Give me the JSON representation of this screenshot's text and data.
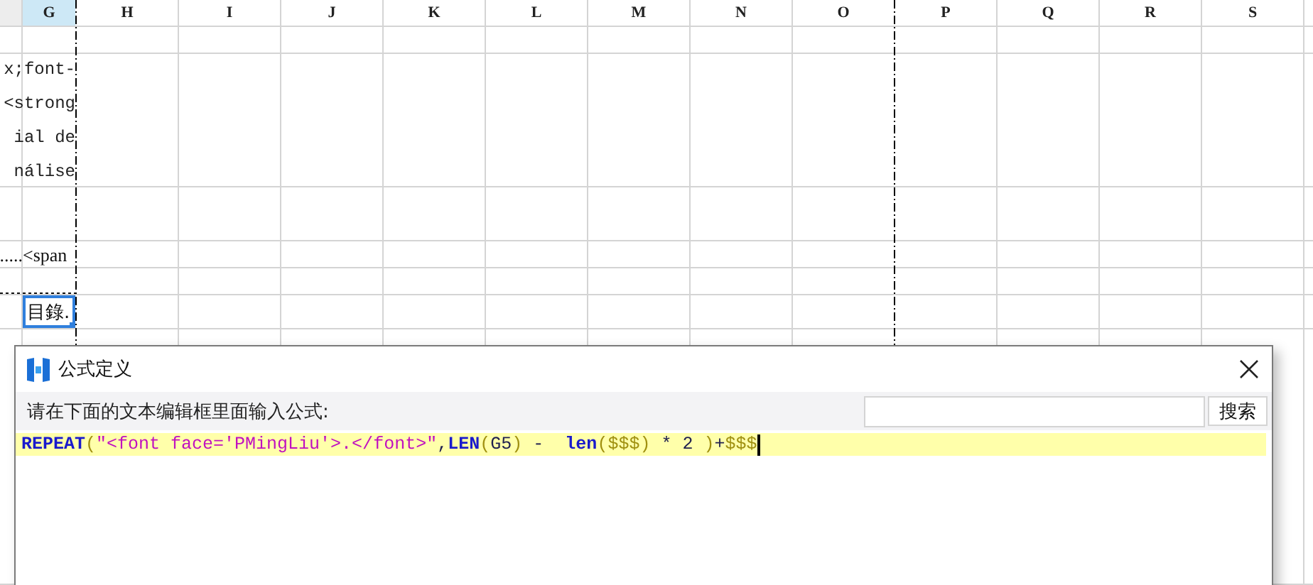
{
  "sheet": {
    "columns": [
      {
        "label": "G",
        "selected": true
      },
      {
        "label": "H",
        "selected": false
      },
      {
        "label": "I",
        "selected": false
      },
      {
        "label": "J",
        "selected": false
      },
      {
        "label": "K",
        "selected": false
      },
      {
        "label": "L",
        "selected": false
      },
      {
        "label": "M",
        "selected": false
      },
      {
        "label": "N",
        "selected": false
      },
      {
        "label": "O",
        "selected": false
      },
      {
        "label": "P",
        "selected": false
      },
      {
        "label": "Q",
        "selected": false
      },
      {
        "label": "R",
        "selected": false
      },
      {
        "label": "S",
        "selected": false
      }
    ],
    "rows": [
      {
        "kind": "plain"
      },
      {
        "kind": "wrapped",
        "lines": [
          "x;font-",
          "<strong",
          "ial de",
          "nálise"
        ]
      },
      {
        "kind": "plain"
      },
      {
        "kind": "split",
        "column_f": ".....",
        "column_g": "<span"
      },
      {
        "kind": "dotted"
      },
      {
        "kind": "cell",
        "column_g": "目錄.",
        "selected": true
      },
      {
        "kind": "plain"
      }
    ]
  },
  "dialog": {
    "title": "公式定义",
    "prompt": "请在下面的文本编辑框里面输入公式:",
    "search_button": "搜索",
    "formula": [
      {
        "kind": "function",
        "text": "REPEAT"
      },
      {
        "kind": "paren",
        "text": "("
      },
      {
        "kind": "string",
        "text": "\"<font face='PMingLiu'>.</font>\""
      },
      {
        "kind": "operator",
        "text": ","
      },
      {
        "kind": "function",
        "text": "LEN"
      },
      {
        "kind": "paren",
        "text": "("
      },
      {
        "kind": "reference",
        "text": "G5"
      },
      {
        "kind": "paren",
        "text": ")"
      },
      {
        "kind": "operator",
        "text": " -  "
      },
      {
        "kind": "function",
        "text": "len"
      },
      {
        "kind": "paren",
        "text": "("
      },
      {
        "kind": "variable",
        "text": "$$$"
      },
      {
        "kind": "paren",
        "text": ")"
      },
      {
        "kind": "operator",
        "text": " * 2 "
      },
      {
        "kind": "paren",
        "text": ")"
      },
      {
        "kind": "operator",
        "text": "+"
      },
      {
        "kind": "variable",
        "text": "$$$"
      }
    ]
  }
}
